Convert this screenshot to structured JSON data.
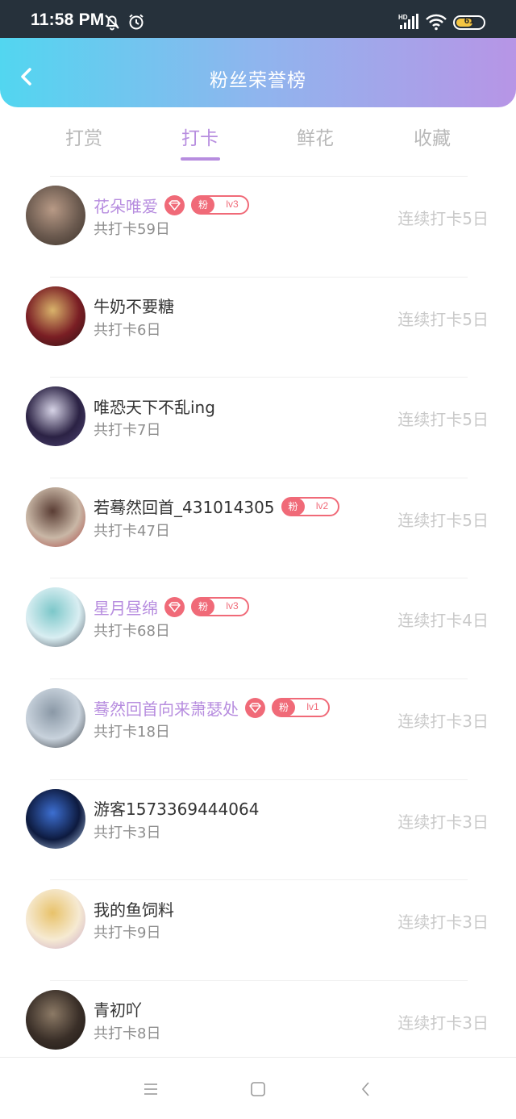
{
  "status_bar": {
    "time": "11:58 PM",
    "battery": "61",
    "battery_level": 0.61,
    "network": "HD"
  },
  "header": {
    "title": "粉丝荣誉榜"
  },
  "tabs": [
    {
      "label": "打赏",
      "active": false
    },
    {
      "label": "打卡",
      "active": true
    },
    {
      "label": "鲜花",
      "active": false
    },
    {
      "label": "收藏",
      "active": false
    }
  ],
  "list": [
    {
      "name": "花朵唯爱",
      "vip": true,
      "diamond": true,
      "fan_label": "粉",
      "fan_level": "lv3",
      "total": "共打卡59日",
      "streak": "连续打卡5日",
      "avatar_colors": [
        "#6b5a4f",
        "#b89a86",
        "#3a3028"
      ]
    },
    {
      "name": "牛奶不要糖",
      "vip": false,
      "diamond": false,
      "fan_label": "",
      "fan_level": "",
      "total": "共打卡6日",
      "streak": "连续打卡5日",
      "avatar_colors": [
        "#7a1e24",
        "#d9b36b",
        "#2a1012"
      ]
    },
    {
      "name": "唯恐天下不乱ing",
      "vip": false,
      "diamond": false,
      "fan_label": "",
      "fan_level": "",
      "total": "共打卡7日",
      "streak": "连续打卡5日",
      "avatar_colors": [
        "#2b2244",
        "#d6d3e6",
        "#514777"
      ]
    },
    {
      "name": "若蓦然回首_431014305",
      "vip": false,
      "diamond": false,
      "fan_label": "粉",
      "fan_level": "lv2",
      "total": "共打卡47日",
      "streak": "连续打卡5日",
      "avatar_colors": [
        "#c9b7a6",
        "#5a3d34",
        "#a8423f"
      ]
    },
    {
      "name": "星月昼绵",
      "vip": true,
      "diamond": true,
      "fan_label": "粉",
      "fan_level": "lv3",
      "total": "共打卡68日",
      "streak": "连续打卡4日",
      "avatar_colors": [
        "#d9eef2",
        "#7cc7c9",
        "#4a4f5c"
      ]
    },
    {
      "name": "蓦然回首向来萧瑟处",
      "vip": true,
      "diamond": true,
      "fan_label": "粉",
      "fan_level": "lv1",
      "total": "共打卡18日",
      "streak": "连续打卡3日",
      "avatar_colors": [
        "#c8d2dc",
        "#8a98a6",
        "#2e3238"
      ]
    },
    {
      "name": "游客1573369444064",
      "vip": false,
      "diamond": false,
      "fan_label": "",
      "fan_level": "",
      "total": "共打卡3日",
      "streak": "连续打卡3日",
      "avatar_colors": [
        "#0d1a3f",
        "#3d6fd1",
        "#b9d1f0"
      ]
    },
    {
      "name": "我的鱼饲料",
      "vip": false,
      "diamond": false,
      "fan_label": "",
      "fan_level": "",
      "total": "共打卡9日",
      "streak": "连续打卡3日",
      "avatar_colors": [
        "#f6ead2",
        "#e8c26a",
        "#c9a6c8"
      ]
    },
    {
      "name": "青初吖",
      "vip": false,
      "diamond": false,
      "fan_label": "",
      "fan_level": "",
      "total": "共打卡8日",
      "streak": "连续打卡3日",
      "avatar_colors": [
        "#3a2f28",
        "#8c7a66",
        "#1c1714"
      ]
    }
  ],
  "colors": {
    "accent": "#b78ddf",
    "badge": "#f06a78",
    "muted": "#c9c9c9"
  },
  "navbar": {
    "icons": [
      "menu-icon",
      "home-square-icon",
      "back-chevron-icon"
    ]
  }
}
